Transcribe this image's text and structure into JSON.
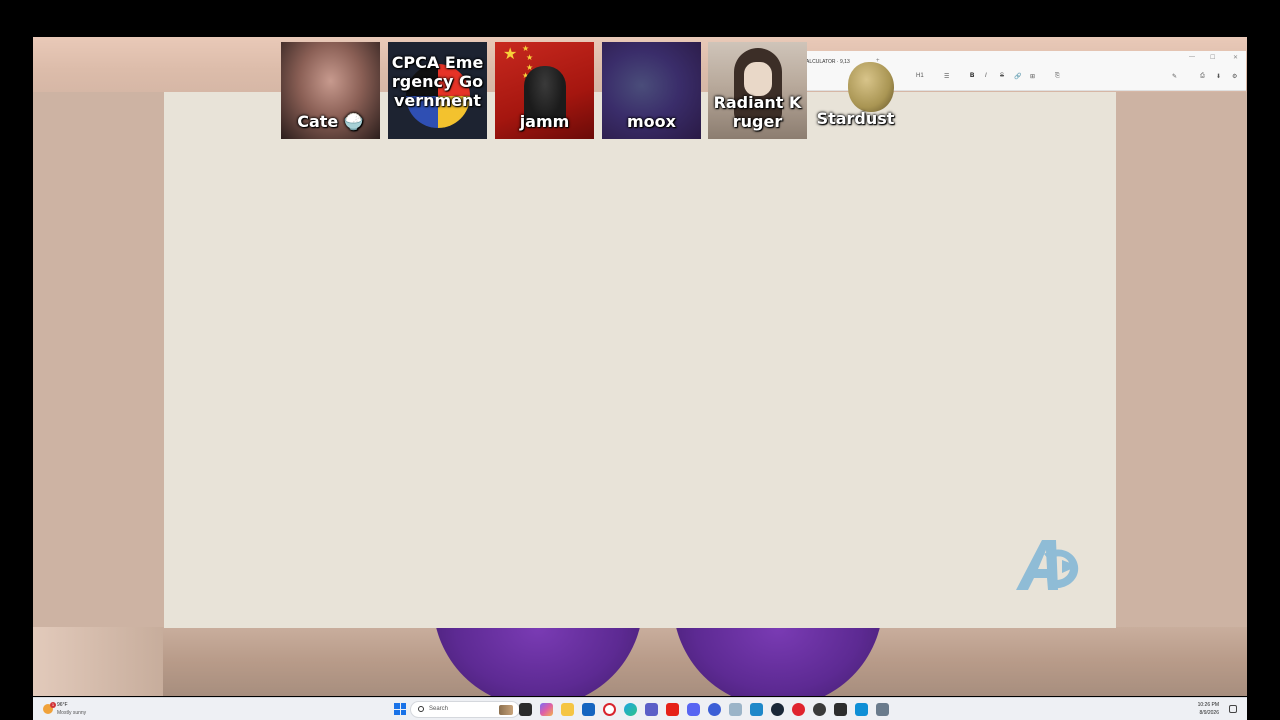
{
  "participants": [
    {
      "name": "Cate 🍚"
    },
    {
      "name": "CPCA Emergency Government"
    },
    {
      "name": "jamm"
    },
    {
      "name": "moox"
    },
    {
      "name": "Radiant Kruger"
    },
    {
      "name": "Stardust"
    }
  ],
  "doc_window": {
    "title": "ALCULATOR · 9,13",
    "tab_add": "+",
    "toolbar": [
      "H1",
      "☰",
      "B",
      "I",
      "S",
      "🔗",
      "⊞",
      "⎘"
    ],
    "right_tools": [
      "✎",
      "⎙",
      "⬇",
      "⚙"
    ]
  },
  "taskbar": {
    "weather_temp": "96°F",
    "weather_condition": "Mostly sunny",
    "weather_badge": "1",
    "search_placeholder": "Search",
    "time": "10:26 PM",
    "date": "8/9/2026"
  },
  "colors": {
    "stage": "#e8e3d8",
    "logo": "#8fbcd6",
    "accent": "#1a73e8"
  }
}
